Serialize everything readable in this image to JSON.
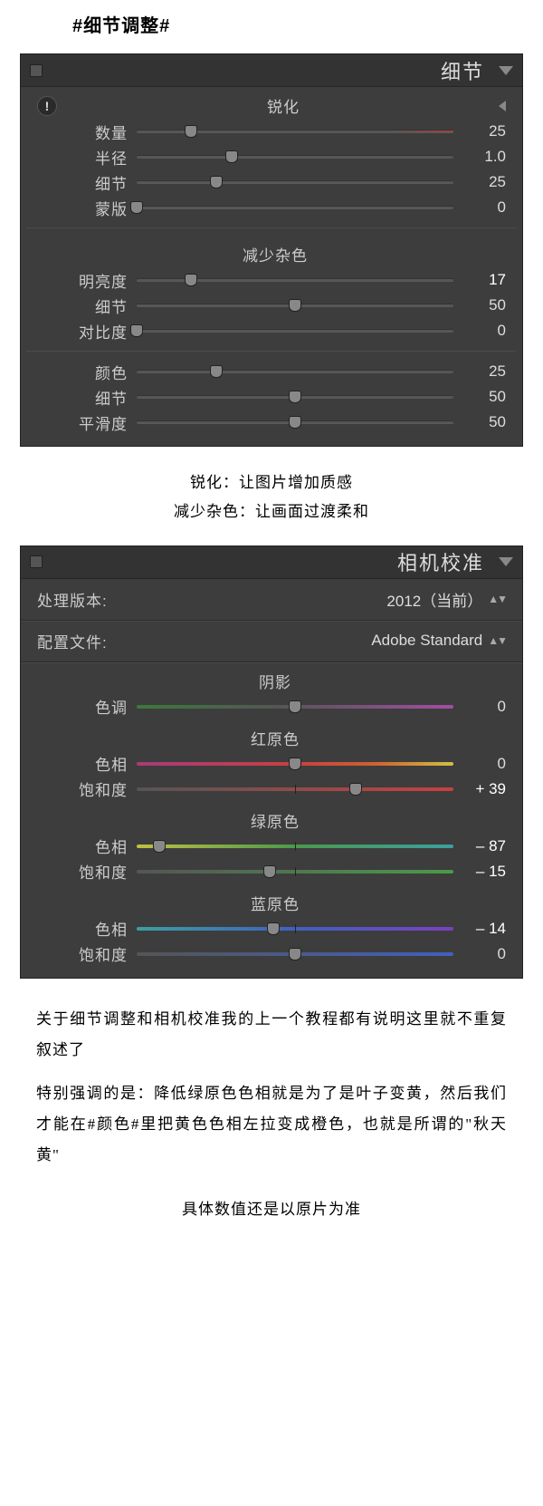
{
  "title": "#细节调整#",
  "detail_panel": {
    "title": "细节",
    "sharpening": {
      "title": "锐化",
      "amount": {
        "label": "数量",
        "value": "25",
        "pos": 17,
        "redtail": true
      },
      "radius": {
        "label": "半径",
        "value": "1.0",
        "pos": 30
      },
      "detail": {
        "label": "细节",
        "value": "25",
        "pos": 25
      },
      "mask": {
        "label": "蒙版",
        "value": "0",
        "pos": 0
      }
    },
    "noise": {
      "title": "减少杂色",
      "lum": {
        "label": "明亮度",
        "value": "17",
        "pos": 17,
        "highlight": true
      },
      "detail": {
        "label": "细节",
        "value": "50",
        "pos": 50
      },
      "contrast": {
        "label": "对比度",
        "value": "0",
        "pos": 0
      }
    },
    "color_noise": {
      "color": {
        "label": "颜色",
        "value": "25",
        "pos": 25
      },
      "detail": {
        "label": "细节",
        "value": "50",
        "pos": 50
      },
      "smooth": {
        "label": "平滑度",
        "value": "50",
        "pos": 50
      }
    }
  },
  "caption": {
    "line1": "锐化：让图片增加质感",
    "line2": "减少杂色：让画面过渡柔和"
  },
  "calib_panel": {
    "title": "相机校准",
    "version": {
      "label": "处理版本:",
      "value": "2012（当前）"
    },
    "profile": {
      "label": "配置文件:",
      "value": "Adobe Standard"
    },
    "shadow": {
      "title": "阴影",
      "tint": {
        "label": "色调",
        "value": "0",
        "pos": 50
      }
    },
    "red": {
      "title": "红原色",
      "hue": {
        "label": "色相",
        "value": "0",
        "pos": 50
      },
      "sat": {
        "label": "饱和度",
        "value": "+ 39",
        "pos": 69
      }
    },
    "green": {
      "title": "绿原色",
      "hue": {
        "label": "色相",
        "value": "– 87",
        "pos": 7
      },
      "sat": {
        "label": "饱和度",
        "value": "– 15",
        "pos": 42
      }
    },
    "blue": {
      "title": "蓝原色",
      "hue": {
        "label": "色相",
        "value": "– 14",
        "pos": 43
      },
      "sat": {
        "label": "饱和度",
        "value": "0",
        "pos": 50
      }
    }
  },
  "notes": {
    "p1": "关于细节调整和相机校准我的上一个教程都有说明这里就不重复叙述了",
    "p2": "特别强调的是：降低绿原色色相就是为了是叶子变黄，然后我们才能在#颜色#里把黄色色相左拉变成橙色，也就是所谓的\"秋天黄\"",
    "final": "具体数值还是以原片为准"
  }
}
